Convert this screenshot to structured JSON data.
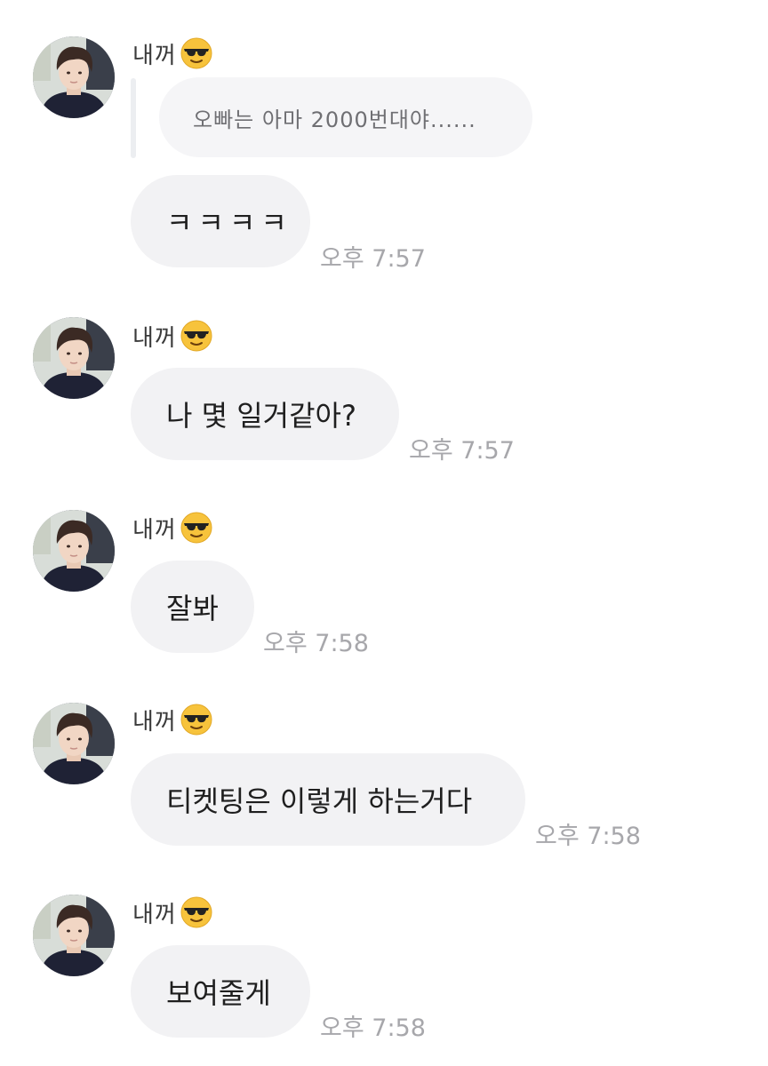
{
  "messages": [
    {
      "sender": "내꺼",
      "sender_emoji": "sunglasses-face-emoji",
      "reply_quote": "오빠는 아마 2000번대야......",
      "text": "ㅋㅋㅋㅋ",
      "time": "오후 7:57"
    },
    {
      "sender": "내꺼",
      "sender_emoji": "sunglasses-face-emoji",
      "text": "나 몇 일거같아?",
      "time": "오후 7:57"
    },
    {
      "sender": "내꺼",
      "sender_emoji": "sunglasses-face-emoji",
      "text": "잘봐",
      "time": "오후 7:58"
    },
    {
      "sender": "내꺼",
      "sender_emoji": "sunglasses-face-emoji",
      "text": "티켓팅은 이렇게 하는거다",
      "time": "오후 7:58"
    },
    {
      "sender": "내꺼",
      "sender_emoji": "sunglasses-face-emoji",
      "text": "보여줄게",
      "time": "오후 7:58"
    }
  ],
  "colors": {
    "bubble": "#f2f2f4",
    "reply_bubble": "#f5f5f7",
    "time_text": "#a7a7ab",
    "message_text": "#1f1f1f"
  }
}
